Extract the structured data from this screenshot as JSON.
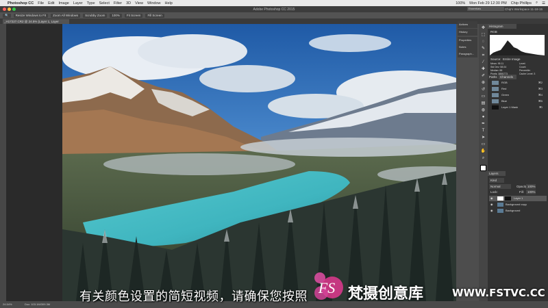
{
  "menubar": {
    "app_name": "Photoshop CC",
    "items": [
      "File",
      "Edit",
      "Image",
      "Layer",
      "Type",
      "Select",
      "Filter",
      "3D",
      "View",
      "Window",
      "Help"
    ],
    "battery": "100%",
    "clock": "Mon Feb 29  12:30 PM",
    "user": "Chip Phillips"
  },
  "titlebar": {
    "title": "Adobe Photoshop CC 2015",
    "workspace": "Essentials",
    "workspace_name": "Chip's Workspace 11-18-15"
  },
  "options_bar": {
    "items": [
      "Resize Windows to Fit",
      "Zoom All Windows",
      "Scrubby Zoom",
      "100%",
      "Fit Screen",
      "Fill Screen"
    ]
  },
  "document_tab": "_H17227.CR2 @ 24.5% (Layer 1, Layer Mask/16) *",
  "mini_panels": [
    "Actions",
    "History",
    "Properties",
    "Notes",
    "Paragraph..."
  ],
  "histogram": {
    "tab": "Histogram",
    "channel": "RGB",
    "source_label": "Source:",
    "source": "Entire Image",
    "stats": [
      "Mean: 95.11",
      "Std Dev: 58.04",
      "Median: 88",
      "Pixels: 3855773",
      "Level:",
      "Count:",
      "Percentile:",
      "Cache Level: 3"
    ]
  },
  "channels": {
    "tabs": [
      "Paths",
      "Channels"
    ],
    "rows": [
      {
        "name": "RGB",
        "shortcut": "⌘2"
      },
      {
        "name": "Red",
        "shortcut": "⌘3"
      },
      {
        "name": "Green",
        "shortcut": "⌘4"
      },
      {
        "name": "Blue",
        "shortcut": "⌘5"
      },
      {
        "name": "Layer 1 Mask",
        "shortcut": "⌘\\"
      }
    ]
  },
  "layers": {
    "tab": "Layers",
    "kind": "Kind",
    "blend_mode": "Normal",
    "opacity_label": "Opacity:",
    "opacity": "100%",
    "lock_label": "Lock:",
    "fill_label": "Fill:",
    "fill": "100%",
    "rows": [
      "Layer 1",
      "Background copy",
      "Background"
    ]
  },
  "status": {
    "zoom": "24.54%",
    "doc": "Doc: 103.1M/309.3M"
  },
  "overlay": {
    "subtitle": "有关颜色设置的简短视频，请确保您按照",
    "watermark_logo": "FS",
    "watermark_name": "梵摄创意库",
    "watermark_url": "WWW.FSTVC.CC"
  },
  "colors": {
    "accent_pink": "#e0388f",
    "panel_bg": "#323232",
    "lake": "#3fb5bf"
  }
}
